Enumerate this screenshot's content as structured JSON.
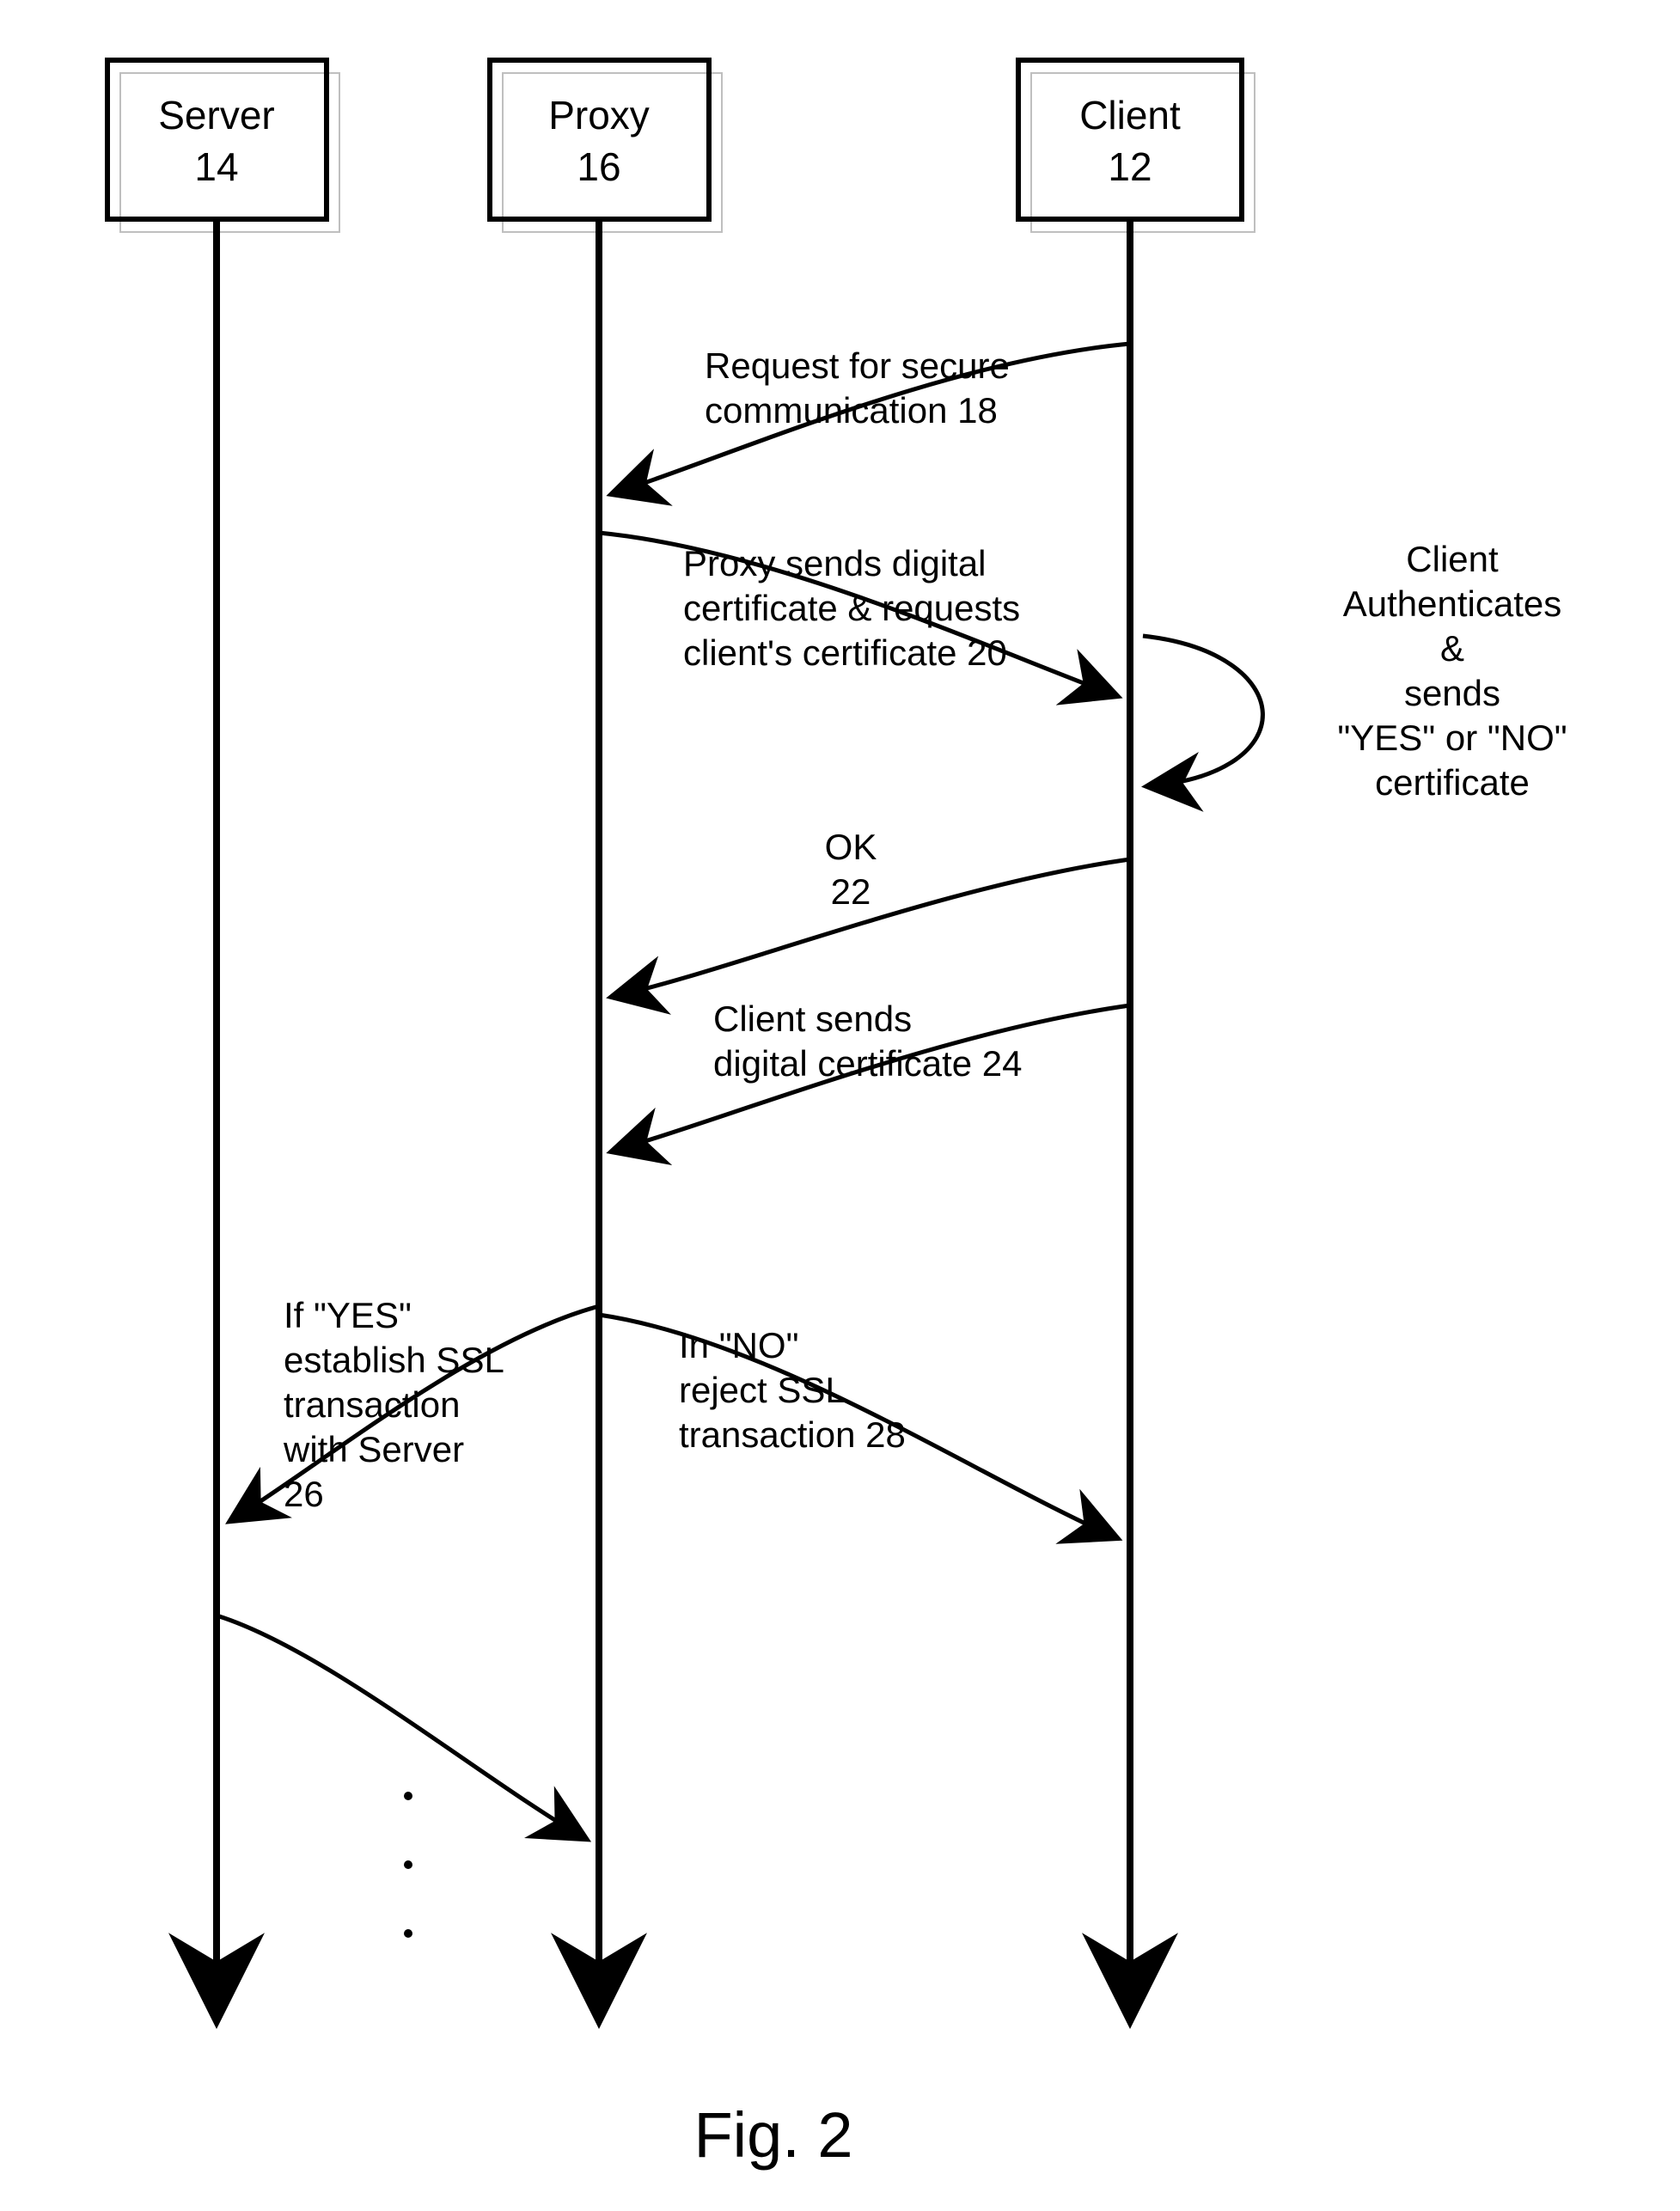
{
  "chart_data": {
    "type": "sequence-diagram",
    "participants": [
      {
        "id": "server",
        "name": "Server",
        "ref": "14"
      },
      {
        "id": "proxy",
        "name": "Proxy",
        "ref": "16"
      },
      {
        "id": "client",
        "name": "Client",
        "ref": "12"
      }
    ],
    "messages": [
      {
        "from": "client",
        "to": "proxy",
        "label": "Request for secure communication 18"
      },
      {
        "from": "proxy",
        "to": "client",
        "label": "Proxy sends digital certificate & requests client's certificate 20"
      },
      {
        "at": "client",
        "self": true,
        "label": "Client Authenticates & sends \"YES\" or \"NO\" certificate"
      },
      {
        "from": "client",
        "to": "proxy",
        "label": "OK 22"
      },
      {
        "from": "client",
        "to": "proxy",
        "label": "Client sends digital certificate 24"
      },
      {
        "from": "proxy",
        "to": "server",
        "label": "If \"YES\" establish SSL transaction with Server 26"
      },
      {
        "from": "proxy",
        "to": "client",
        "label": "In \"NO\" reject SSL transaction 28"
      },
      {
        "from": "server",
        "to": "proxy",
        "label": "",
        "continuation": true
      }
    ],
    "caption": "Fig. 2"
  },
  "labels": {
    "server_name": "Server",
    "server_ref": "14",
    "proxy_name": "Proxy",
    "proxy_ref": "16",
    "client_name": "Client",
    "client_ref": "12",
    "m_request_l1": "Request for secure",
    "m_request_l2": "communication 18",
    "m_proxy_l1": "Proxy sends digital",
    "m_proxy_l2": "certificate & requests",
    "m_proxy_l3": "client's certificate 20",
    "m_auth_l1": "Client",
    "m_auth_l2": "Authenticates",
    "m_auth_l3": "&",
    "m_auth_l4": "sends",
    "m_auth_l5": "\"YES\" or \"NO\"",
    "m_auth_l6": "certificate",
    "m_ok_l1": "OK",
    "m_ok_l2": "22",
    "m_send_l1": "Client sends",
    "m_send_l2": "digital certificate 24",
    "m_yes_l1": "If \"YES\"",
    "m_yes_l2": "establish SSL",
    "m_yes_l3": "transaction",
    "m_yes_l4": "with Server",
    "m_yes_l5": "26",
    "m_no_l1": "In \"NO\"",
    "m_no_l2": "reject SSL",
    "m_no_l3": "transaction 28",
    "caption": "Fig. 2"
  }
}
